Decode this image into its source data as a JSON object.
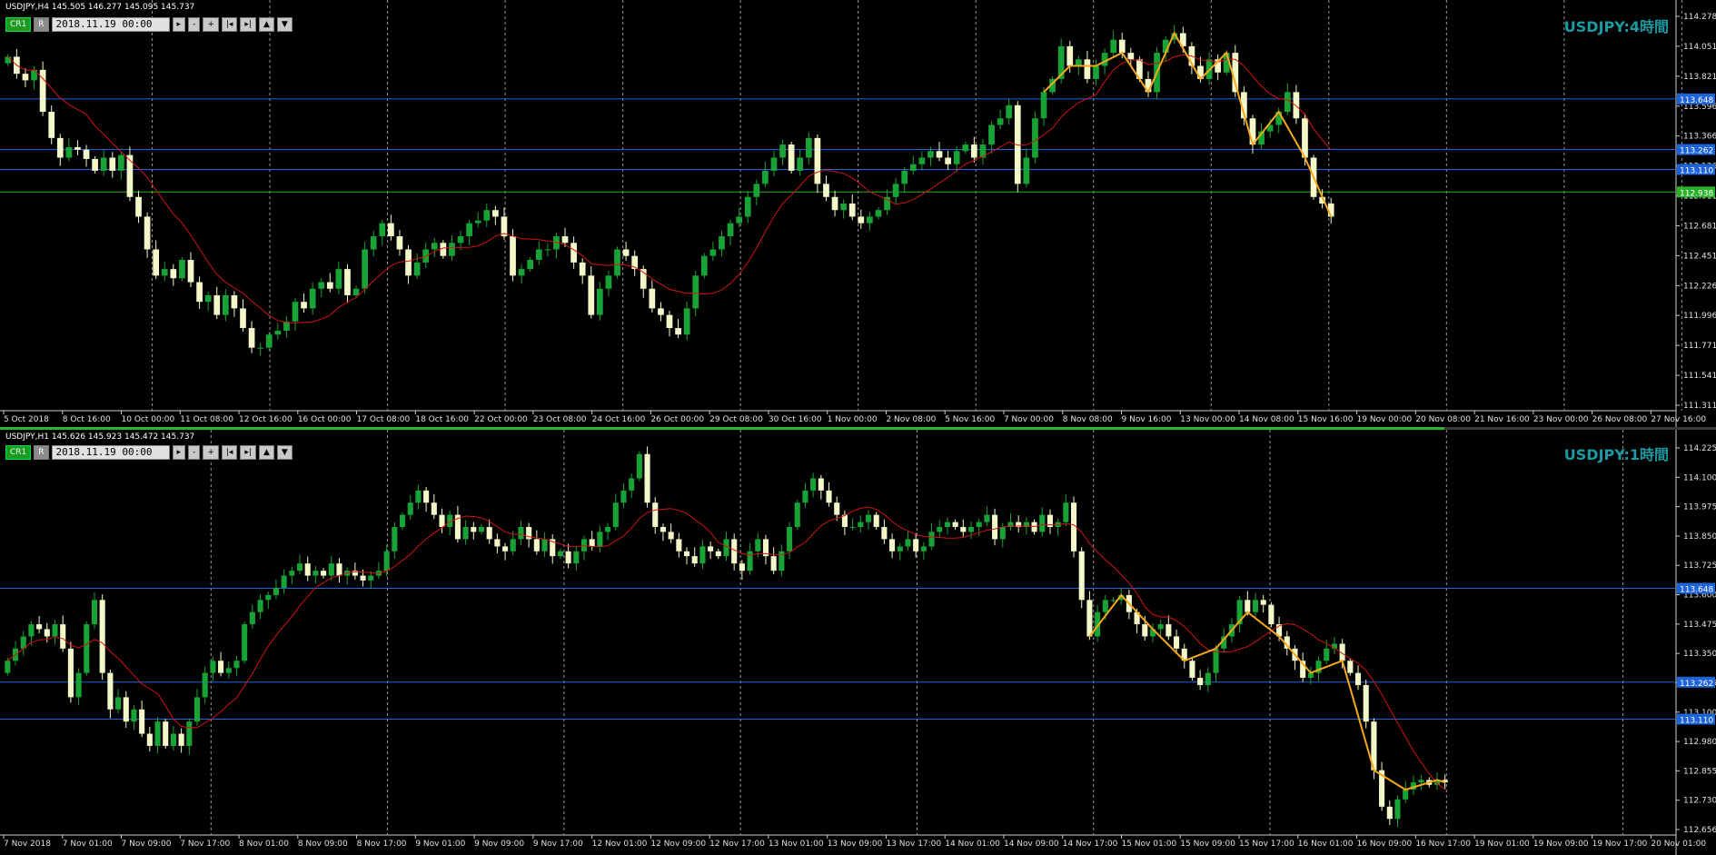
{
  "top": {
    "header": "USDJPY,H4  145.505 146.277 145.095 145.737",
    "toolbar": {
      "cr_label": "CR1",
      "r_label": "R",
      "date": "2018.11.19 00:00",
      "play": "▸",
      "minus": "-",
      "plus": "+",
      "first": "|◂",
      "last": "▸|",
      "up": "▲",
      "down": "▼"
    },
    "title": "USDJPY:4時間"
  },
  "bottom": {
    "header": "USDJPY,H1  145.626 145.923 145.472 145.737",
    "toolbar": {
      "cr_label": "CR1",
      "r_label": "R",
      "date": "2018.11.19 00:00",
      "play": "▸",
      "minus": "-",
      "plus": "+",
      "first": "|◂",
      "last": "▸|",
      "up": "▲",
      "down": "▼"
    },
    "title": "USDJPY:1時間"
  },
  "colors": {
    "bull": "#17a335",
    "bear": "#f4f7c8",
    "ma": "#d01414",
    "zigzag": "#f5a81e",
    "level": "#1e64d8",
    "support": "#29b129",
    "title": "#1a9aa3",
    "grid": "#9a9a9a"
  },
  "chart_data": [
    {
      "type": "candlestick",
      "title": "USDJPY:4時間",
      "symbol": "USDJPY,H4",
      "ohlc_header": {
        "open": 145.505,
        "high": 146.277,
        "low": 145.095,
        "close": 145.737
      },
      "ylim": [
        111.311,
        114.278
      ],
      "y_ticks": [
        "114.278",
        "114.051",
        "113.821",
        "113.596",
        "113.366",
        "113.136",
        "112.911",
        "112.681",
        "112.451",
        "112.226",
        "111.996",
        "111.771",
        "111.541",
        "111.311"
      ],
      "x_ticks": [
        "5 Oct 2018",
        "8 Oct 16:00",
        "10 Oct 00:00",
        "11 Oct 08:00",
        "12 Oct 16:00",
        "16 Oct 00:00",
        "17 Oct 08:00",
        "18 Oct 16:00",
        "22 Oct 00:00",
        "23 Oct 08:00",
        "24 Oct 16:00",
        "26 Oct 00:00",
        "29 Oct 08:00",
        "30 Oct 16:00",
        "1 Nov 00:00",
        "2 Nov 08:00",
        "5 Nov 16:00",
        "7 Nov 00:00",
        "8 Nov 08:00",
        "9 Nov 16:00",
        "13 Nov 00:00",
        "14 Nov 08:00",
        "15 Nov 16:00",
        "19 Nov 00:00",
        "20 Nov 08:00",
        "21 Nov 16:00",
        "23 Nov 00:00",
        "26 Nov 08:00",
        "27 Nov 16:00"
      ],
      "levels": [
        {
          "value": "113.648",
          "color": "level"
        },
        {
          "value": "113.262",
          "color": "level"
        },
        {
          "value": "113.110",
          "color": "level"
        },
        {
          "value": "112.938",
          "color": "support"
        }
      ],
      "close": [
        113.97,
        113.84,
        113.79,
        113.87,
        113.55,
        113.35,
        113.2,
        113.28,
        113.26,
        113.19,
        113.1,
        113.2,
        113.1,
        113.22,
        112.9,
        112.75,
        112.5,
        112.3,
        112.35,
        112.28,
        112.42,
        112.25,
        112.1,
        112.15,
        112.0,
        112.15,
        112.05,
        111.9,
        111.75,
        111.75,
        111.85,
        111.88,
        111.95,
        112.1,
        112.05,
        112.2,
        112.25,
        112.2,
        112.35,
        112.15,
        112.2,
        112.5,
        112.6,
        112.7,
        112.6,
        112.5,
        112.3,
        112.4,
        112.5,
        112.55,
        112.45,
        112.55,
        112.6,
        112.7,
        112.72,
        112.8,
        112.75,
        112.6,
        112.3,
        112.35,
        112.42,
        112.5,
        112.5,
        112.6,
        112.55,
        112.4,
        112.3,
        112.0,
        112.2,
        112.3,
        112.5,
        112.45,
        112.35,
        112.2,
        112.05,
        112.0,
        111.9,
        111.85,
        112.05,
        112.3,
        112.45,
        112.5,
        112.6,
        112.7,
        112.75,
        112.9,
        113.0,
        113.1,
        113.2,
        113.3,
        113.1,
        113.2,
        113.35,
        113.0,
        112.9,
        112.8,
        112.85,
        112.75,
        112.7,
        112.75,
        112.8,
        112.9,
        113.0,
        113.1,
        113.15,
        113.2,
        113.25,
        113.2,
        113.15,
        113.25,
        113.3,
        113.2,
        113.3,
        113.45,
        113.5,
        113.6,
        113.0,
        113.2,
        113.5,
        113.7,
        113.8,
        114.05,
        113.9,
        113.95,
        113.8,
        113.9,
        114.0,
        114.1,
        114.0,
        113.95,
        113.8,
        113.7,
        114.0,
        114.1,
        114.15,
        114.05,
        113.9,
        113.8,
        113.95,
        113.85,
        114.0,
        113.7,
        113.5,
        113.3,
        113.4,
        113.45,
        113.55,
        113.7,
        113.5,
        113.2,
        112.9,
        112.85,
        112.75
      ]
    },
    {
      "type": "candlestick",
      "title": "USDJPY:1時間",
      "symbol": "USDJPY,H1",
      "ohlc_header": {
        "open": 145.626,
        "high": 145.923,
        "low": 145.472,
        "close": 145.737
      },
      "ylim": [
        112.656,
        114.225
      ],
      "y_ticks": [
        "114.225",
        "114.100",
        "113.975",
        "113.850",
        "113.725",
        "113.600",
        "113.475",
        "113.350",
        "113.225",
        "113.100",
        "112.980",
        "112.855",
        "112.730",
        "112.656"
      ],
      "x_ticks": [
        "7 Nov 2018",
        "7 Nov 01:00",
        "7 Nov 09:00",
        "7 Nov 17:00",
        "8 Nov 01:00",
        "8 Nov 09:00",
        "8 Nov 17:00",
        "9 Nov 01:00",
        "9 Nov 09:00",
        "9 Nov 17:00",
        "12 Nov 01:00",
        "12 Nov 09:00",
        "12 Nov 17:00",
        "13 Nov 01:00",
        "13 Nov 09:00",
        "13 Nov 17:00",
        "14 Nov 01:00",
        "14 Nov 09:00",
        "14 Nov 17:00",
        "15 Nov 01:00",
        "15 Nov 09:00",
        "15 Nov 17:00",
        "16 Nov 01:00",
        "16 Nov 09:00",
        "16 Nov 17:00",
        "19 Nov 01:00",
        "19 Nov 09:00",
        "19 Nov 17:00",
        "20 Nov 01:00"
      ],
      "levels": [
        {
          "value": "113.648",
          "color": "level"
        },
        {
          "value": "113.262",
          "color": "level"
        },
        {
          "value": "113.110",
          "color": "level"
        }
      ],
      "close": [
        113.35,
        113.4,
        113.45,
        113.5,
        113.48,
        113.45,
        113.5,
        113.4,
        113.2,
        113.3,
        113.5,
        113.6,
        113.3,
        113.15,
        113.2,
        113.1,
        113.15,
        113.05,
        113.0,
        113.1,
        113.0,
        113.05,
        113.0,
        113.1,
        113.2,
        113.3,
        113.35,
        113.3,
        113.32,
        113.35,
        113.5,
        113.55,
        113.6,
        113.62,
        113.65,
        113.7,
        113.72,
        113.75,
        113.7,
        113.72,
        113.7,
        113.75,
        113.7,
        113.72,
        113.7,
        113.68,
        113.7,
        113.72,
        113.8,
        113.9,
        113.95,
        114.0,
        114.05,
        114.0,
        113.95,
        113.9,
        113.95,
        113.85,
        113.9,
        113.88,
        113.9,
        113.85,
        113.82,
        113.8,
        113.85,
        113.9,
        113.85,
        113.8,
        113.85,
        113.78,
        113.8,
        113.75,
        113.8,
        113.85,
        113.82,
        113.88,
        113.9,
        114.0,
        114.05,
        114.1,
        114.2,
        114.0,
        113.9,
        113.88,
        113.85,
        113.8,
        113.78,
        113.75,
        113.82,
        113.8,
        113.78,
        113.85,
        113.75,
        113.72,
        113.8,
        113.85,
        113.78,
        113.72,
        113.8,
        113.9,
        114.0,
        114.05,
        114.1,
        114.05,
        114.0,
        113.95,
        113.9,
        113.9,
        113.92,
        113.95,
        113.9,
        113.85,
        113.8,
        113.82,
        113.85,
        113.8,
        113.82,
        113.88,
        113.9,
        113.92,
        113.9,
        113.88,
        113.9,
        113.92,
        113.95,
        113.85,
        113.9,
        113.92,
        113.9,
        113.92,
        113.88,
        113.95,
        113.9,
        113.92,
        114.0,
        113.8,
        113.6,
        113.45,
        113.55,
        113.6,
        113.6,
        113.62,
        113.55,
        113.5,
        113.45,
        113.48,
        113.5,
        113.45,
        113.4,
        113.35,
        113.28,
        113.25,
        113.3,
        113.4,
        113.45,
        113.5,
        113.6,
        113.55,
        113.6,
        113.58,
        113.5,
        113.45,
        113.4,
        113.35,
        113.28,
        113.3,
        113.35,
        113.4,
        113.42,
        113.35,
        113.3,
        113.25,
        113.1,
        112.9,
        112.75,
        112.7,
        112.78,
        112.82,
        112.85,
        112.86,
        112.84,
        112.86,
        112.85
      ]
    }
  ]
}
